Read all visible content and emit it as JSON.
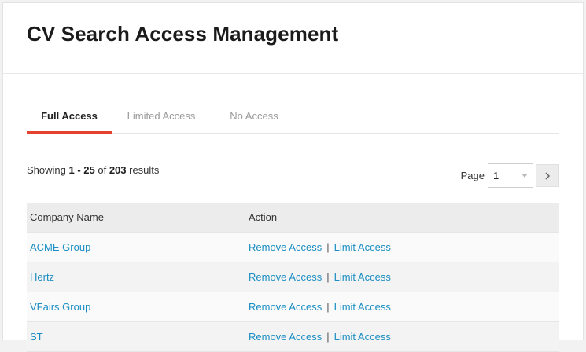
{
  "page": {
    "title": "CV Search Access Management"
  },
  "tabs": [
    {
      "label": "Full Access",
      "active": true
    },
    {
      "label": "Limited Access",
      "active": false
    },
    {
      "label": "No Access",
      "active": false
    }
  ],
  "results": {
    "prefix": "Showing ",
    "range": "1 - 25",
    "of": " of ",
    "total": "203",
    "suffix": " results"
  },
  "pagination": {
    "label": "Page",
    "selected": "1",
    "next_icon": "chevron-right-icon"
  },
  "table": {
    "columns": [
      "Company Name",
      "Action"
    ],
    "rows": [
      {
        "company": "ACME Group",
        "action_remove": "Remove Access",
        "separator": "|",
        "action_limit": "Limit Access"
      },
      {
        "company": "Hertz",
        "action_remove": "Remove Access",
        "separator": "|",
        "action_limit": "Limit Access"
      },
      {
        "company": "VFairs Group",
        "action_remove": "Remove Access",
        "separator": "|",
        "action_limit": "Limit Access"
      },
      {
        "company": "ST",
        "action_remove": "Remove Access",
        "separator": "|",
        "action_limit": "Limit Access"
      }
    ]
  },
  "colors": {
    "accent": "#e4412f",
    "link": "#1a8ec3"
  }
}
